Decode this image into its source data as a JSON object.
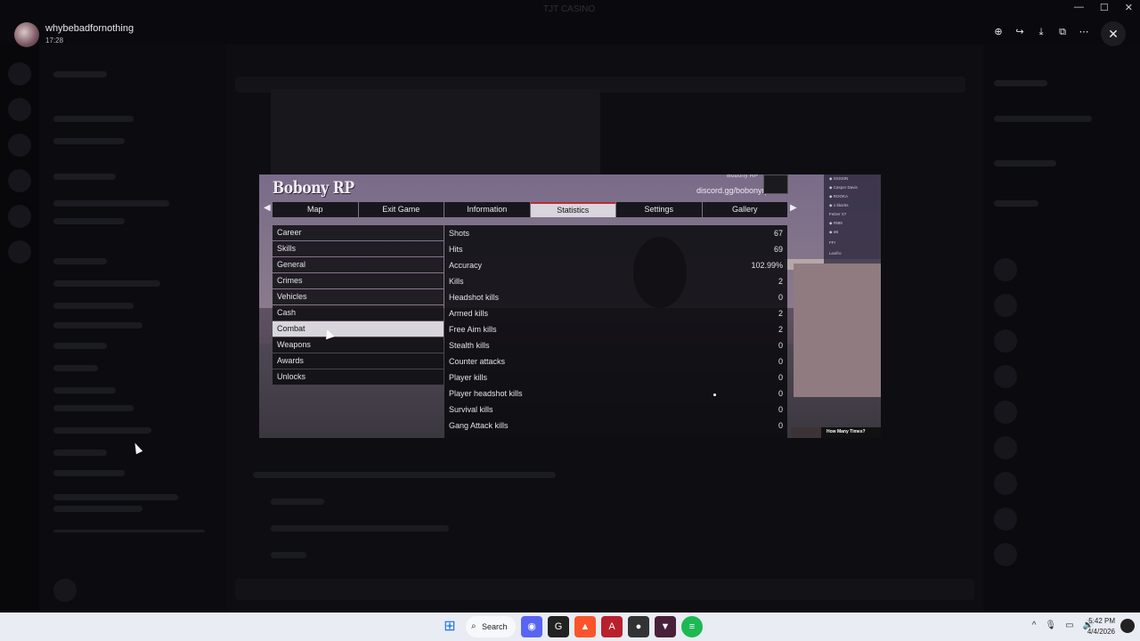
{
  "window": {
    "title": "TJT CASINO",
    "controls": [
      "—",
      "☐",
      "✕"
    ]
  },
  "viewer": {
    "uploader": "whybebadfornothing",
    "time": "17:28",
    "actions": [
      "zoom-icon",
      "forward-icon",
      "download-icon",
      "open-icon",
      "more-icon"
    ],
    "close": "✕"
  },
  "game": {
    "logo": "Bobony RP",
    "discord": "discord.gg/bobonyrp",
    "tabs": [
      "Map",
      "Exit Game",
      "Information",
      "Statistics",
      "Settings",
      "Gallery"
    ],
    "active_tab": "Statistics",
    "categories": [
      "Career",
      "Skills",
      "General",
      "Crimes",
      "Vehicles",
      "Cash",
      "Combat",
      "Weapons",
      "Awards",
      "Unlocks"
    ],
    "active_category": "Combat",
    "stats": [
      {
        "name": "Shots",
        "value": "67"
      },
      {
        "name": "Hits",
        "value": "69"
      },
      {
        "name": "Accuracy",
        "value": "102.99%"
      },
      {
        "name": "Kills",
        "value": "2"
      },
      {
        "name": "Headshot kills",
        "value": "0"
      },
      {
        "name": "Armed kills",
        "value": "2"
      },
      {
        "name": "Free Aim kills",
        "value": "2"
      },
      {
        "name": "Stealth kills",
        "value": "0"
      },
      {
        "name": "Counter attacks",
        "value": "0"
      },
      {
        "name": "Player kills",
        "value": "0"
      },
      {
        "name": "Player headshot kills",
        "value": "0"
      },
      {
        "name": "Survival kills",
        "value": "0"
      },
      {
        "name": "Gang Attack kills",
        "value": "0"
      }
    ],
    "clip_text": "How Many Times?"
  },
  "taskbar": {
    "search": "Search",
    "time": "5:42 PM",
    "date": "4/4/2026"
  },
  "colors": {
    "tab_accent": "#b92a3a",
    "taskbar": "#e9ecf2"
  }
}
